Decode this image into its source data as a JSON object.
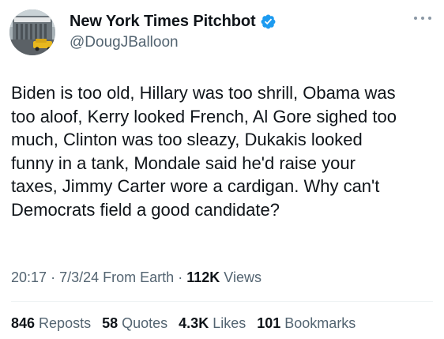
{
  "tweet": {
    "author": {
      "display_name": "New York Times Pitchbot",
      "handle": "@DougJBalloon",
      "verified_icon": "verified-badge-icon",
      "verified_color": "#1d9bf0"
    },
    "text": "Biden is too old, Hillary was too shrill, Obama was\ntoo aloof, Kerry looked French, Al Gore sighed too\nmuch, Clinton was too sleazy, Dukakis looked\nfunny in a tank, Mondale said he'd raise your\ntaxes, Jimmy Carter wore a cardigan. Why can't\nDemocrats field a good candidate?",
    "time": "20:17",
    "date": "7/3/24",
    "source": "From Earth",
    "separator": "·",
    "views_count": "112K",
    "views_label": "Views",
    "stats": [
      {
        "count": "846",
        "label": "Reposts"
      },
      {
        "count": "58",
        "label": "Quotes"
      },
      {
        "count": "4.3K",
        "label": "Likes"
      },
      {
        "count": "101",
        "label": "Bookmarks"
      }
    ]
  }
}
